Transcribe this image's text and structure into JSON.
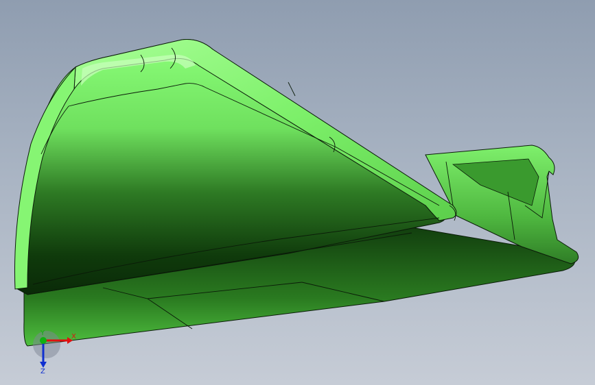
{
  "viewport": {
    "background_top": "#8f9db0",
    "background_bottom": "#c6ccd6"
  },
  "model": {
    "part_color": "#77f066",
    "highlight_color": "#9dff8a",
    "shadow_color": "#0b2a08",
    "edge_color": "#0a1a08"
  },
  "triad": {
    "x_label": "X",
    "y_label": "Y",
    "z_label": "Z",
    "x_color": "#e01010",
    "y_color": "#10b010",
    "z_color": "#1030d0"
  }
}
